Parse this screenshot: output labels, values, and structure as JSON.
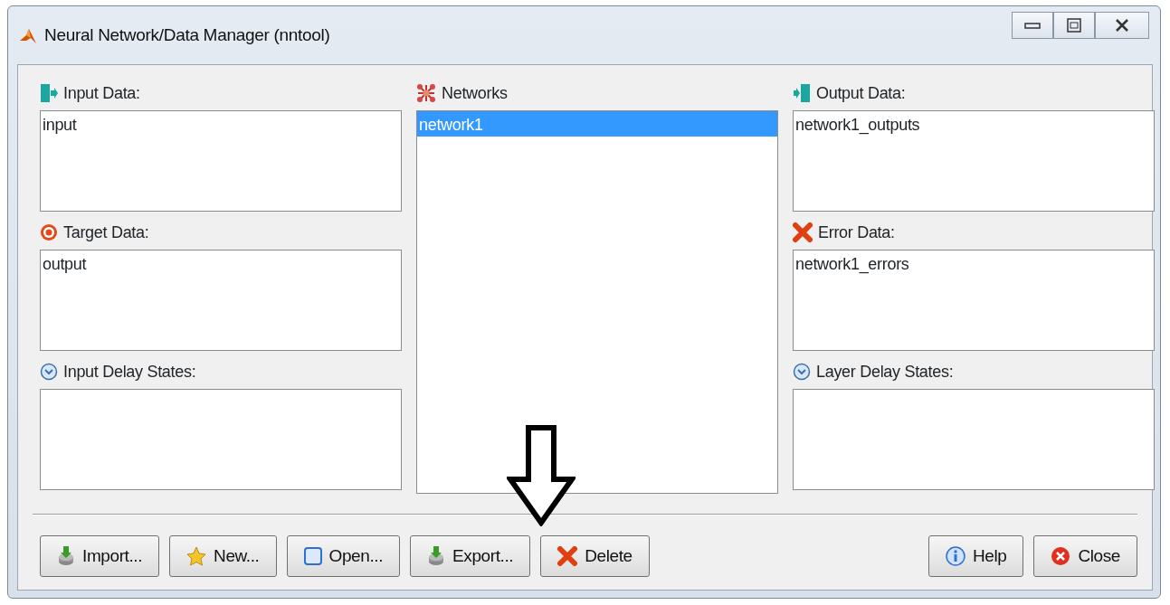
{
  "window": {
    "title": "Neural Network/Data Manager (nntool)"
  },
  "columns": [
    {
      "panels": [
        {
          "label": "Input Data:",
          "items": [
            {
              "text": "input",
              "selected": false
            }
          ]
        },
        {
          "label": "Target Data:",
          "items": [
            {
              "text": "output",
              "selected": false
            }
          ]
        },
        {
          "label": "Input Delay States:"
        }
      ]
    },
    {
      "panels": [
        {
          "label": "Networks",
          "items": [
            {
              "text": "network1",
              "selected": true
            }
          ]
        }
      ]
    },
    {
      "panels": [
        {
          "label": "Output Data:",
          "items": [
            {
              "text": "network1_outputs",
              "selected": false
            }
          ]
        },
        {
          "label": "Error Data:",
          "items": [
            {
              "text": "network1_errors",
              "selected": false
            }
          ]
        },
        {
          "label": "Layer Delay States:"
        }
      ]
    }
  ],
  "buttons": [
    {
      "label": "Import..."
    },
    {
      "label": "New..."
    },
    {
      "label": "Open..."
    },
    {
      "label": "Export..."
    },
    {
      "label": "Delete"
    },
    {
      "label": "Help"
    },
    {
      "label": "Close"
    }
  ]
}
